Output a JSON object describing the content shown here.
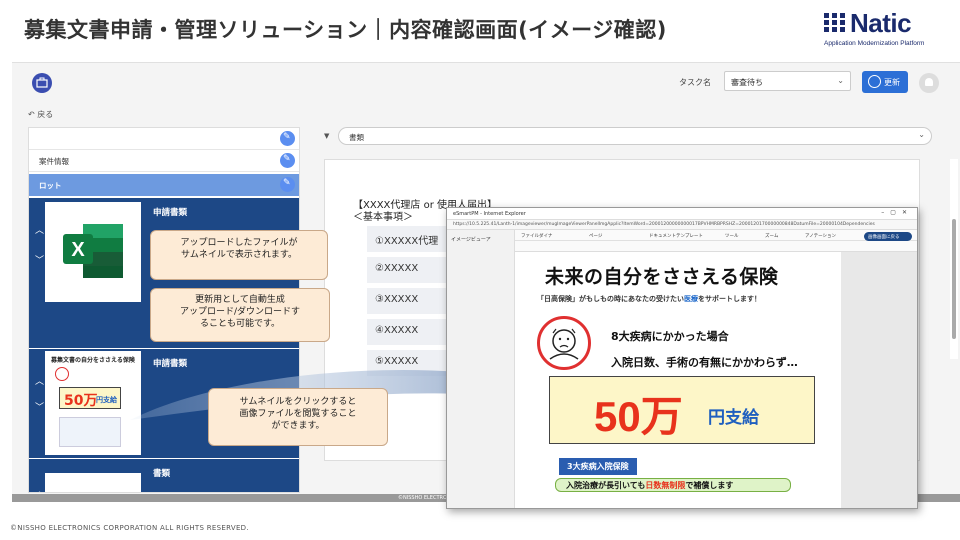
{
  "slide": {
    "title": "募集文書申請・管理ソリューション｜内容確認画面(イメージ確認)",
    "logo_text": "Natic",
    "logo_sub": "Application Modernization Platform",
    "footer": "©NISSHO ELECTRONICS CORPORATION ALL RIGHTS RESERVED."
  },
  "header": {
    "task_label": "タスク名",
    "task_value": "審査待ち",
    "update_label": "更新"
  },
  "nav": {
    "back_label": "戻る"
  },
  "left_panel": {
    "rows": [
      {
        "label": ""
      },
      {
        "label": "案件情報"
      },
      {
        "label": "ロット"
      }
    ],
    "docs": [
      {
        "title": "申請書類"
      },
      {
        "title": "申請書類"
      },
      {
        "title": "書類"
      }
    ],
    "thumb2_lines": [
      "募集文書の自分をささえる保険",
      "50万",
      "円支給"
    ]
  },
  "right_panel": {
    "select_label": "書類",
    "heading1": "【XXXX代理店 or 使用人届出】",
    "heading2": "＜基本事項＞",
    "items": [
      "①XXXXX代理",
      "②XXXXX",
      "③XXXXX",
      "④XXXXX",
      "⑤XXXXX"
    ]
  },
  "viewer": {
    "window_title": "eSmartPM - Internet Explorer",
    "url": "https://10.5.225.41/Lanth-1/imageviewer/mugImageViewerPanelImgApplic?ItemWord=20001200000000017BPVHMRBPRSHZ=2000120170000000848DatumFile=20000104Dependencies",
    "side_label": "イメージビューア",
    "menu": [
      "ファイルダイナ",
      "ページ",
      "ドキュメントテンプレート",
      "ツール",
      "ズーム",
      "アノテーション"
    ],
    "edit_button": "画像画面に戻る",
    "flyer": {
      "title": "未来の自分をささえる保険",
      "subtitle_pre": "「日高保険」がもしもの時にあなたの受けたい",
      "subtitle_hl": "医療",
      "subtitle_post": "をサポートします！",
      "line1": "8大疾病にかかった場合",
      "line2": "入院日数、手術の有無にかかわらず…",
      "amount": "50万",
      "unit": "円支給",
      "tag": "3大疾病入院保険",
      "bottom_pre": "入院治療が長引いても",
      "bottom_hl": "日数無制限",
      "bottom_post": "で補償します"
    }
  },
  "callouts": {
    "c1": "アップロードしたファイルが\nサムネイルで表示されます。",
    "c2": "更新用として自動生成\nアップロード/ダウンロードす\nることも可能です。",
    "c3": "サムネイルをクリックすると\n画像ファイルを閲覧すること\nができます。"
  },
  "copyright_bar": "©NISSHO ELECTRONICS CORPORATION"
}
